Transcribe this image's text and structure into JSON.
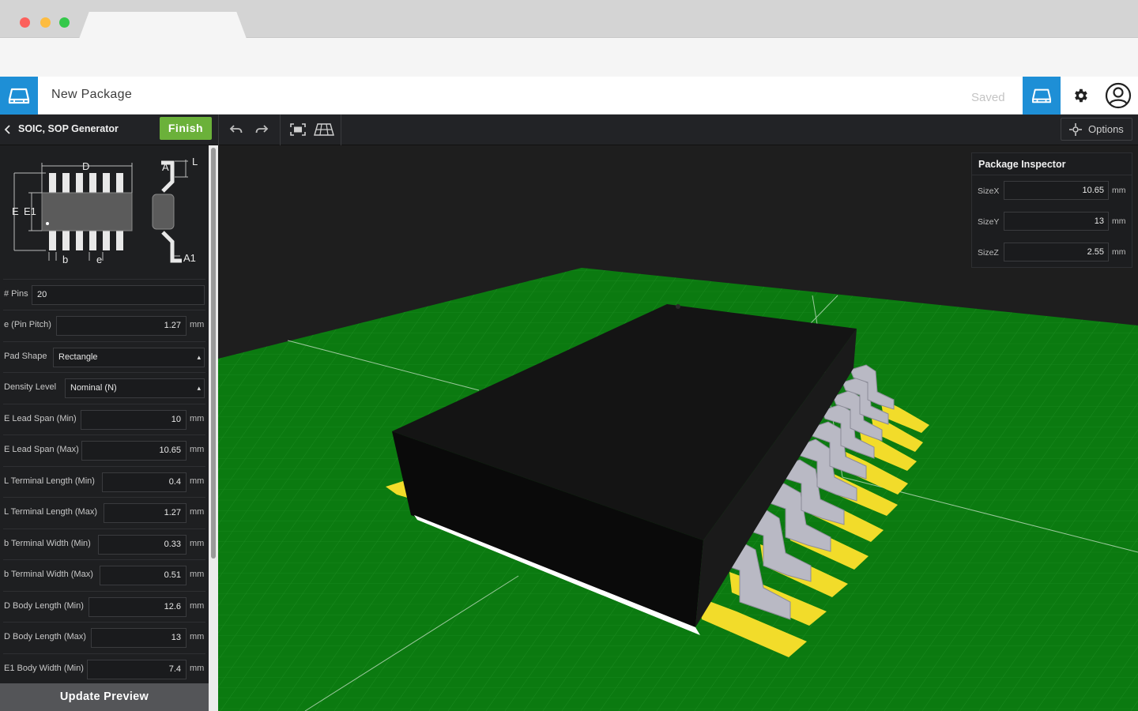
{
  "app": {
    "title": "New Package",
    "status": "Saved"
  },
  "toolbar": {
    "generator_title": "SOIC, SOP Generator",
    "finish_label": "Finish",
    "options_label": "Options"
  },
  "diagram": {
    "labels": {
      "D": "D",
      "E": "E",
      "E1": "E1",
      "b": "b",
      "e": "e",
      "A": "A",
      "L": "L",
      "A1": "A1"
    }
  },
  "params": [
    {
      "label": "# Pins",
      "value": "20",
      "unit": ""
    },
    {
      "label": "e (Pin Pitch)",
      "value": "1.27",
      "unit": "mm"
    },
    {
      "label": "Pad Shape",
      "value": "Rectangle",
      "unit": "",
      "type": "select"
    },
    {
      "label": "Density Level",
      "value": "Nominal (N)",
      "unit": "",
      "type": "select"
    },
    {
      "label": "E Lead Span (Min)",
      "value": "10",
      "unit": "mm"
    },
    {
      "label": "E Lead Span (Max)",
      "value": "10.65",
      "unit": "mm"
    },
    {
      "label": "L Terminal Length (Min)",
      "value": "0.4",
      "unit": "mm"
    },
    {
      "label": "L Terminal Length (Max)",
      "value": "1.27",
      "unit": "mm"
    },
    {
      "label": "b Terminal Width (Min)",
      "value": "0.33",
      "unit": "mm"
    },
    {
      "label": "b Terminal Width (Max)",
      "value": "0.51",
      "unit": "mm"
    },
    {
      "label": "D Body Length (Min)",
      "value": "12.6",
      "unit": "mm"
    },
    {
      "label": "D Body Length (Max)",
      "value": "13",
      "unit": "mm"
    },
    {
      "label": "E1 Body Width (Min)",
      "value": "7.4",
      "unit": "mm"
    }
  ],
  "update_label": "Update Preview",
  "inspector": {
    "title": "Package Inspector",
    "rows": [
      {
        "label": "SizeX",
        "value": "10.65",
        "unit": "mm"
      },
      {
        "label": "SizeY",
        "value": "13",
        "unit": "mm"
      },
      {
        "label": "SizeZ",
        "value": "2.55",
        "unit": "mm"
      }
    ]
  },
  "colors": {
    "accent": "#1e8fd6",
    "finish": "#6bb13a",
    "board": "#0a7a0f",
    "pad": "#f2dc2a",
    "body": "#0e0e0e",
    "lead": "#b9b9c4"
  },
  "icons": [
    "package-icon",
    "gear-icon",
    "user-icon",
    "undo-icon",
    "redo-icon",
    "fit-view-icon",
    "grid-view-icon",
    "options-icon",
    "back-icon"
  ]
}
